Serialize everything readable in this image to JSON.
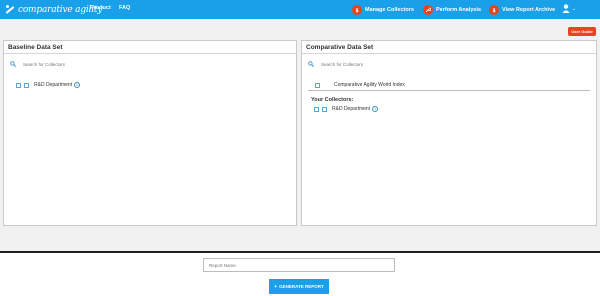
{
  "header": {
    "brand": "comparative agility",
    "nav": {
      "product": "Product",
      "faq": "FAQ"
    },
    "actions": {
      "manage_collectors": "Manage Collectors",
      "perform_analysis": "Perform Analysis",
      "view_report_archive": "View Report Archive"
    },
    "accent_color": "#1aa0e8",
    "badge_color": "#e8431c",
    "icons": {
      "manage_collectors": "dollar-icon",
      "perform_analysis": "wrench-icon",
      "view_report_archive": "dollar-icon",
      "user": "user-icon"
    }
  },
  "user_guide_label": "User Guide",
  "baseline": {
    "title": "Baseline Data Set",
    "search_placeholder": "Search for Collectors",
    "items": [
      {
        "label": "R&D Department"
      }
    ]
  },
  "comparative": {
    "title": "Comparative Data Set",
    "search_placeholder": "Search for Collectors",
    "index_item": "Comparative Agility World Index",
    "collectors_heading": "Your Collectors:",
    "items": [
      {
        "label": "R&D Department"
      }
    ]
  },
  "footer": {
    "report_name_placeholder": "Report Name",
    "generate_label": "GENERATE REPORT"
  }
}
